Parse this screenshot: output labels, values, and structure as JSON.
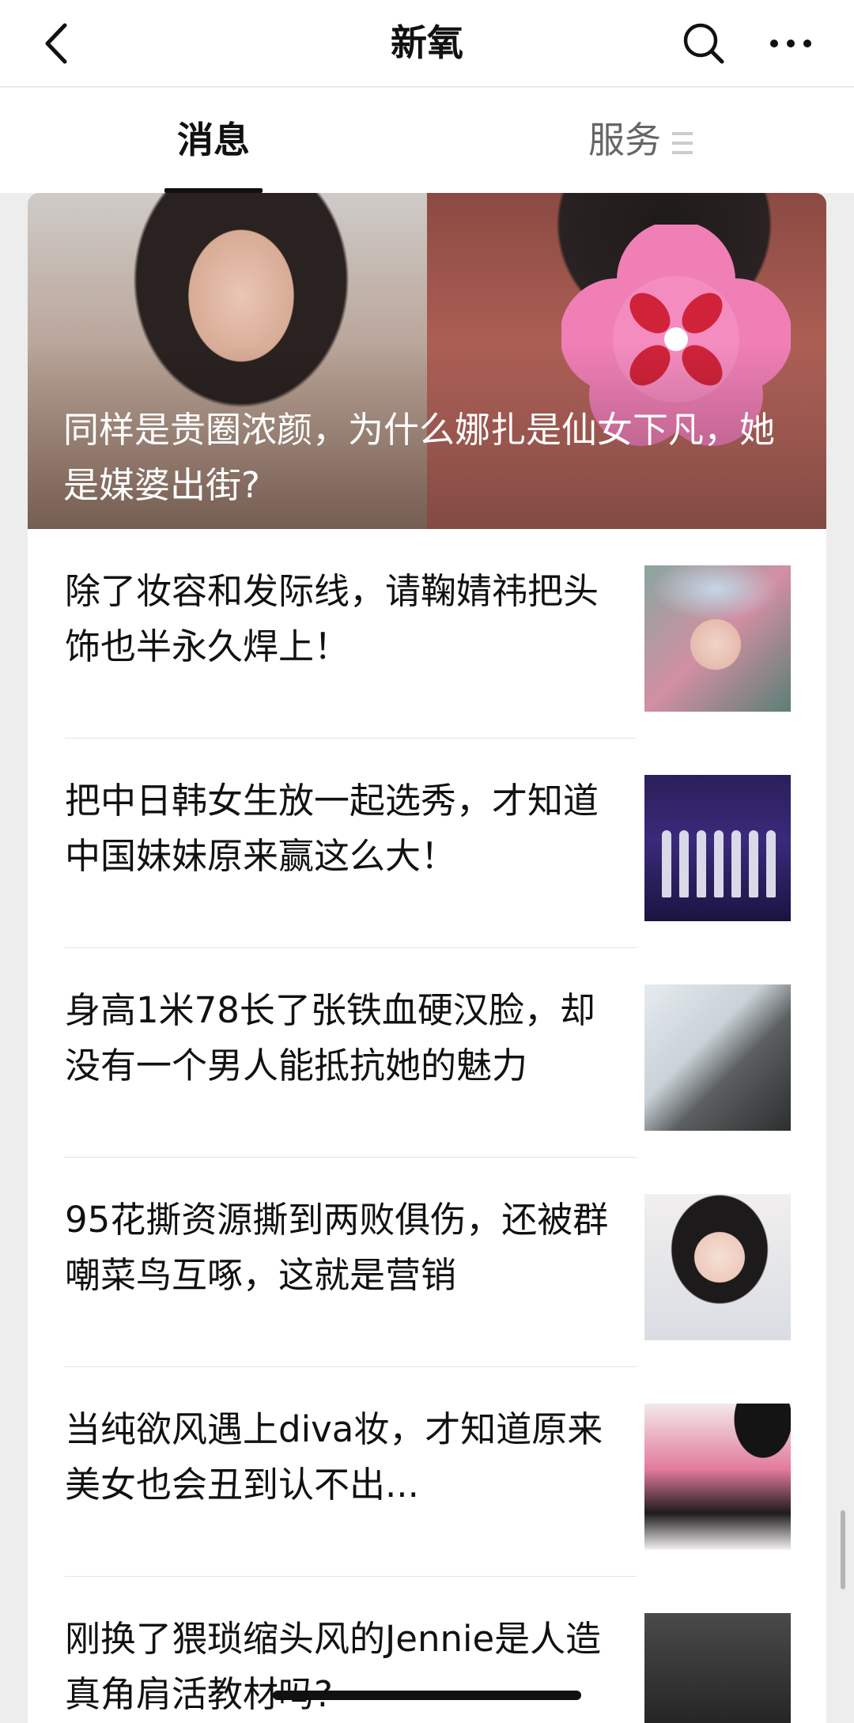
{
  "header": {
    "title": "新氧",
    "back_icon": "chevron-left-icon",
    "search_icon": "search-icon",
    "more_icon": "more-horizontal-icon"
  },
  "tabs": [
    {
      "label": "消息",
      "active": true
    },
    {
      "label": "服务",
      "active": false,
      "icon": "menu-lines-icon"
    }
  ],
  "hero": {
    "title": "同样是贵圈浓颜，为什么娜扎是仙女下凡，她是媒婆出街?"
  },
  "articles": [
    {
      "title": "除了妆容和发际线，请鞠婧祎把头饰也半永久焊上！"
    },
    {
      "title": "把中日韩女生放一起选秀，才知道中国妹妹原来赢这么大！"
    },
    {
      "title": "身高1米78长了张铁血硬汉脸，却没有一个男人能抵抗她的魅力"
    },
    {
      "title": "95花撕资源撕到两败俱伤，还被群嘲菜鸟互啄，这就是营销"
    },
    {
      "title": "当纯欲风遇上diva妆，才知道原来美女也会丑到认不出..."
    },
    {
      "title": "刚换了猥琐缩头风的Jennie是人造真角肩活教材吗?"
    }
  ],
  "colors": {
    "background": "#ededed",
    "surface": "#ffffff",
    "text": "#111111",
    "muted": "#666666"
  }
}
